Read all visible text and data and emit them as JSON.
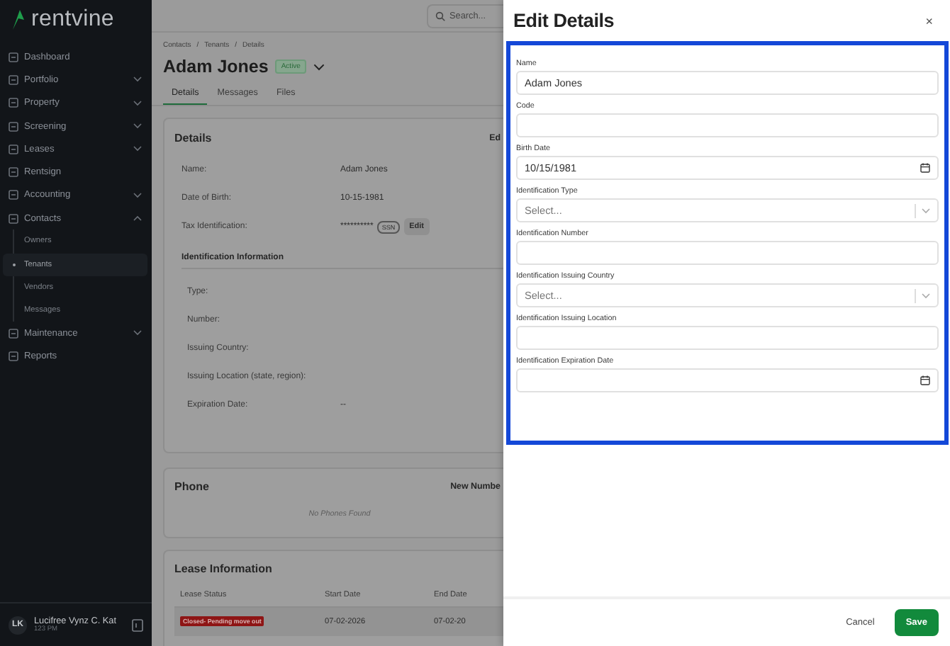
{
  "sidebar": {
    "logo": "rentvine",
    "items": [
      {
        "label": "Dashboard"
      },
      {
        "label": "Portfolio",
        "expanded": false
      },
      {
        "label": "Property",
        "expanded": false
      },
      {
        "label": "Screening",
        "expanded": false
      },
      {
        "label": "Leases",
        "expanded": false
      },
      {
        "label": "Rentsign"
      },
      {
        "label": "Accounting",
        "expanded": false
      },
      {
        "label": "Contacts",
        "expanded": true,
        "children": [
          {
            "label": "Owners",
            "selected": false
          },
          {
            "label": "Tenants",
            "selected": true
          },
          {
            "label": "Vendors",
            "selected": false
          },
          {
            "label": "Messages",
            "selected": false
          }
        ]
      },
      {
        "label": "Maintenance",
        "expanded": false
      },
      {
        "label": "Reports"
      }
    ],
    "user": {
      "initials": "LK",
      "name": "Lucifree Vynz C. Kat",
      "time": "123 PM"
    }
  },
  "topbar": {
    "search": {
      "placeholder": "Search..."
    }
  },
  "header": {
    "breadcrumb": [
      "Contacts",
      "Tenants",
      "Details"
    ],
    "separator": "/",
    "name": "Adam Jones",
    "status": "Active",
    "tabs": [
      {
        "label": "Details",
        "selected": true
      },
      {
        "label": "Messages",
        "selected": false
      },
      {
        "label": "Files",
        "selected": false
      }
    ]
  },
  "details_card": {
    "title": "Details",
    "action": "Ed",
    "rows": [
      {
        "label": "Name:",
        "value": "Adam Jones"
      },
      {
        "label": "Date of Birth:",
        "value": "10-15-1981"
      },
      {
        "label": "Tax Identification:",
        "value": "**********",
        "tag": "SSN",
        "button": "Edit"
      }
    ],
    "section": {
      "title": "Identification Information",
      "rows": [
        {
          "label": "Type:"
        },
        {
          "label": "Number:"
        },
        {
          "label": "Issuing Country:"
        },
        {
          "label": "Issuing Location (state, region):"
        },
        {
          "label": "Expiration Date:",
          "value": "--"
        }
      ]
    }
  },
  "phone_card": {
    "title": "Phone",
    "action": "New Numbe",
    "empty": "No Phones Found"
  },
  "lease_card": {
    "title": "Lease Information",
    "columns": [
      "Lease Status",
      "Start Date",
      "End Date"
    ],
    "rows": [
      {
        "status": "Closed- Pending move out",
        "start": "07-02-2026",
        "end": "07-02-20"
      }
    ]
  },
  "drawer": {
    "title": "Edit Details",
    "close": "×",
    "fields": [
      {
        "kind": "text",
        "label": "Name",
        "value": "Adam Jones"
      },
      {
        "kind": "text",
        "label": "Code"
      },
      {
        "kind": "date",
        "label": "Birth Date",
        "value": "10/15/1981"
      },
      {
        "kind": "select",
        "label": "Identification Type",
        "placeholder": "Select..."
      },
      {
        "kind": "text",
        "label": "Identification Number"
      },
      {
        "kind": "select",
        "label": "Identification Issuing Country",
        "placeholder": "Select..."
      },
      {
        "kind": "text",
        "label": "Identification Issuing Location"
      },
      {
        "kind": "date",
        "label": "Identification Expiration Date"
      }
    ],
    "buttons": {
      "cancel": "Cancel",
      "save": "Save"
    }
  }
}
